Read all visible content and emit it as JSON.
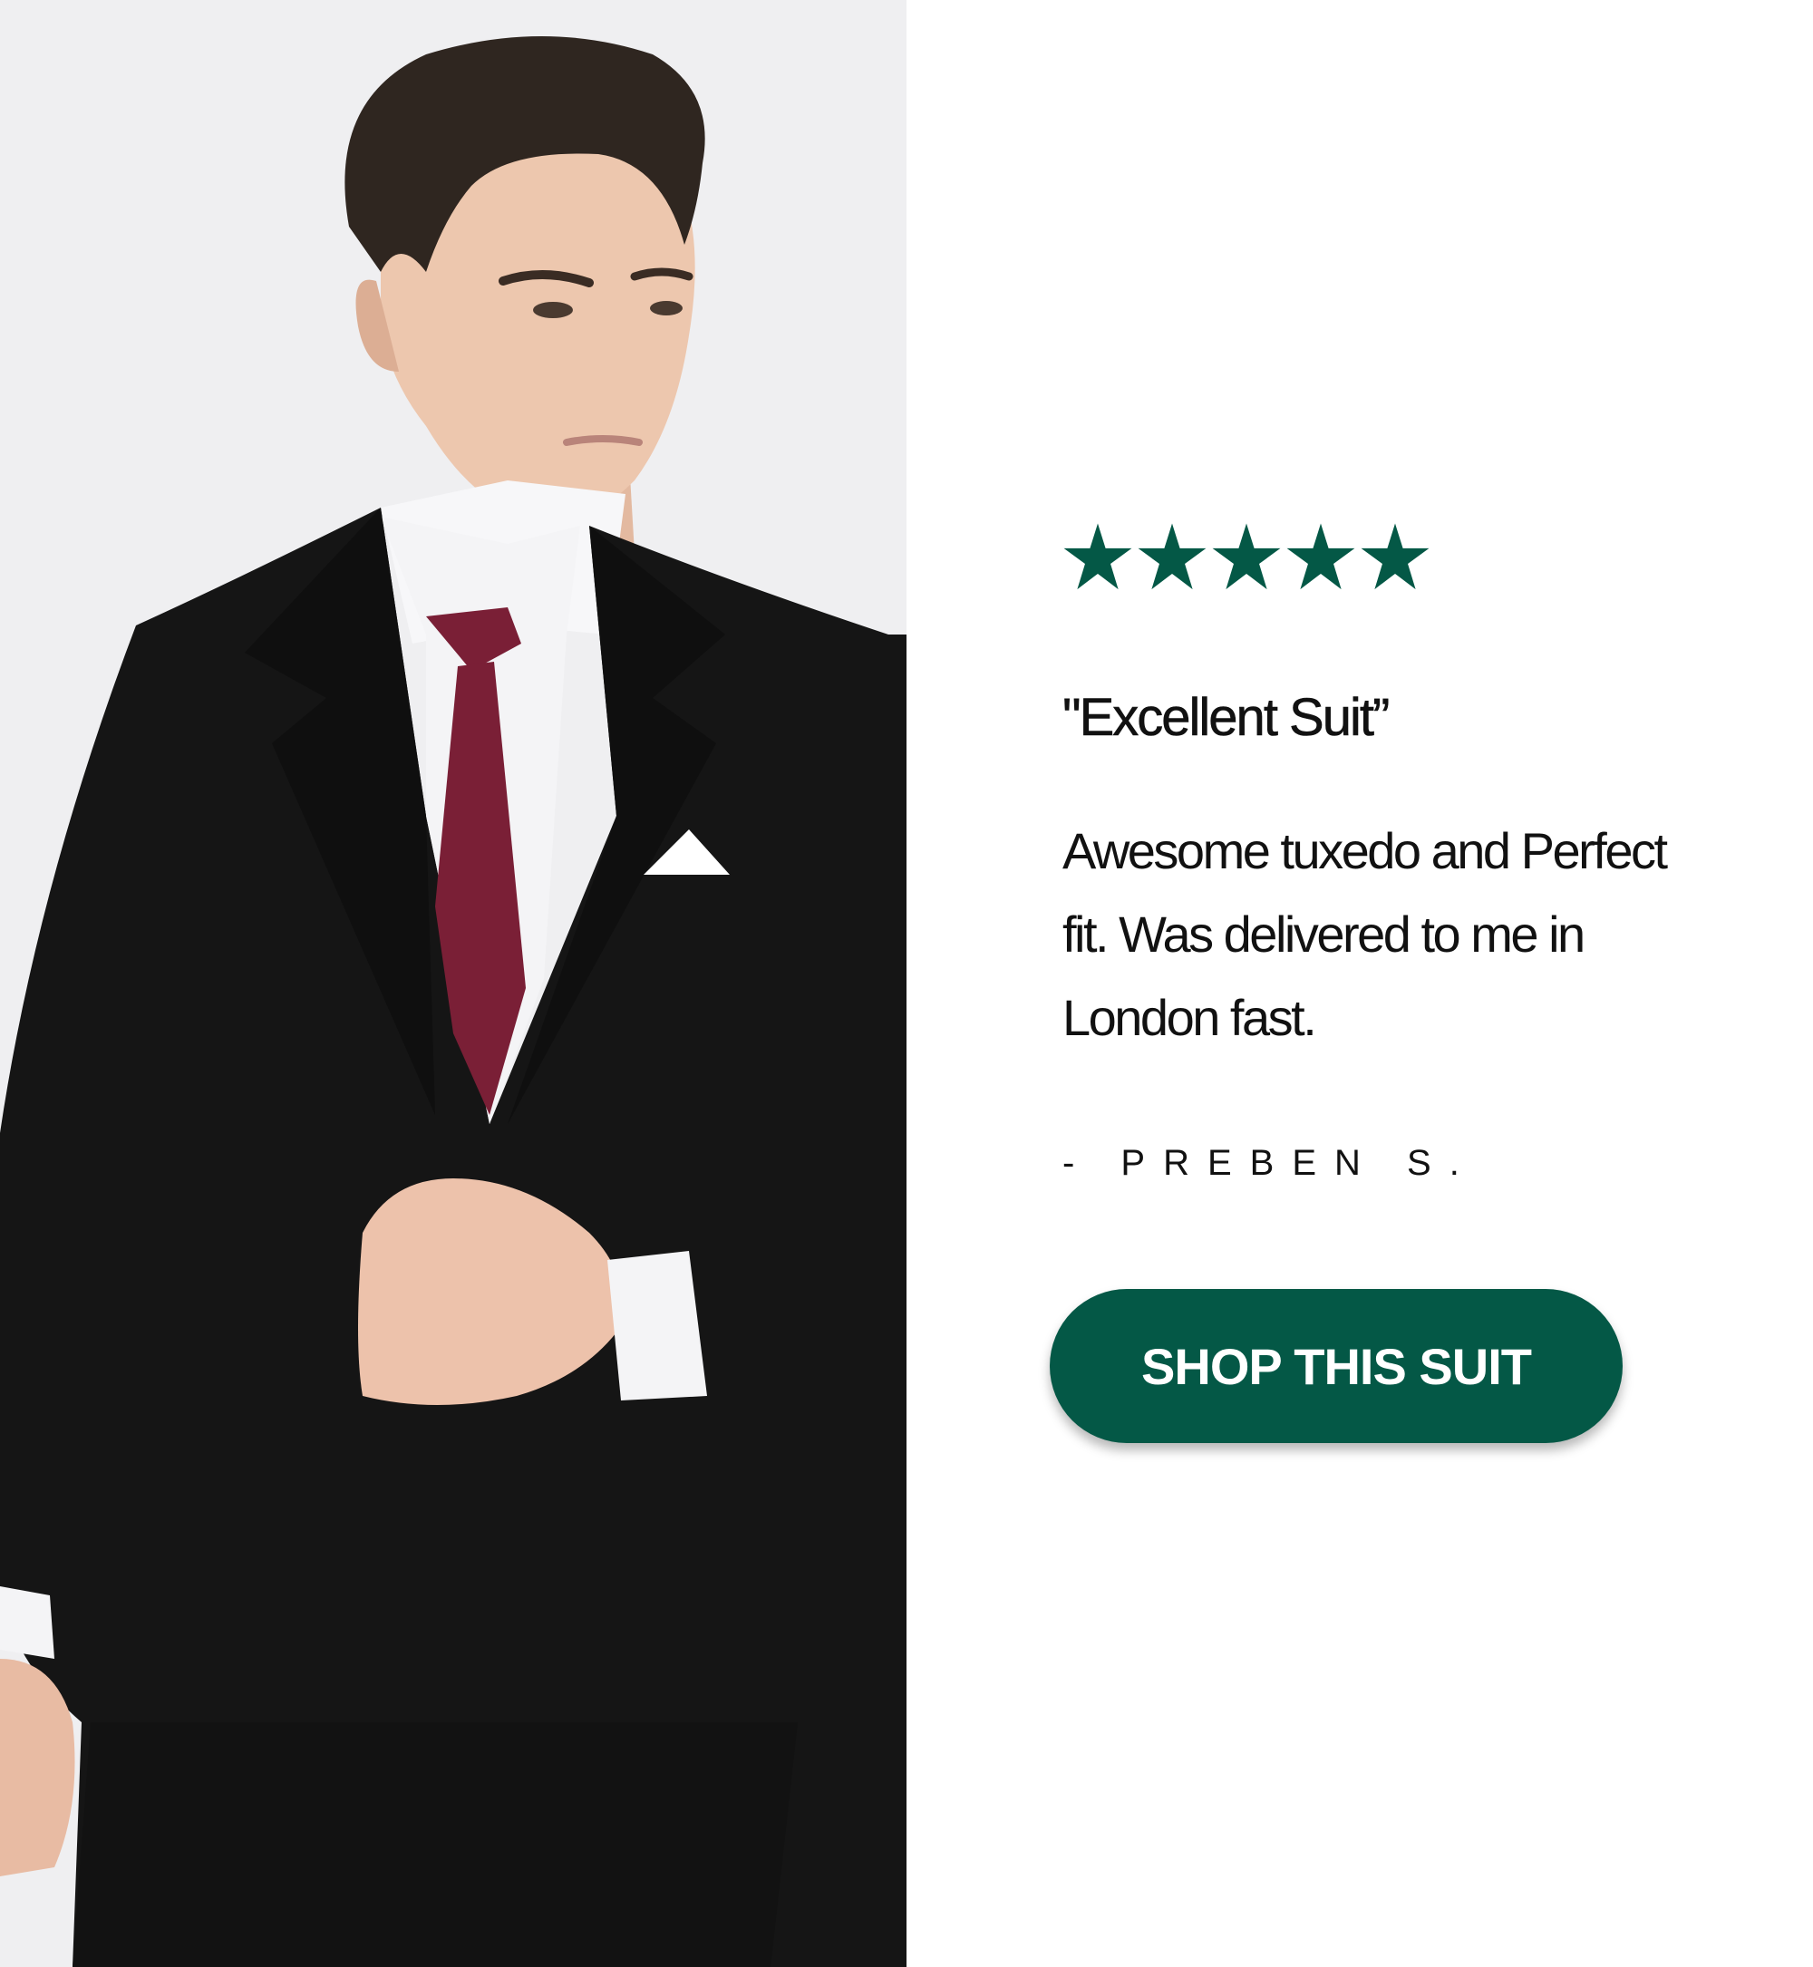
{
  "theme": {
    "accent": "#045846",
    "text": "#111111",
    "background": "#ffffff",
    "photo_background": "#efeff1",
    "tie": "#7a1f36",
    "suit": "#151515"
  },
  "review": {
    "rating": 5,
    "rating_max": 5,
    "star_icon": "star-icon",
    "title": "\"Excellent Suit”",
    "body": "Awesome tuxedo and Perfect fit. Was delivered to me in London fast.",
    "author": "- PREBEN S."
  },
  "cta": {
    "label": "SHOP THIS SUIT"
  }
}
